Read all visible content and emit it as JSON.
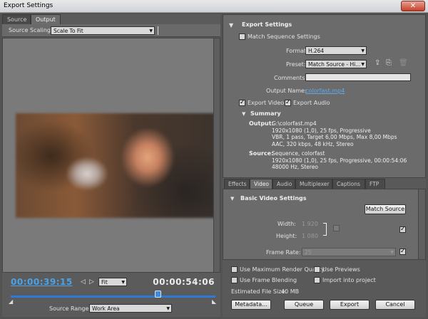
{
  "window": {
    "title": "Export Settings",
    "close_glyph": "✕"
  },
  "left": {
    "tabs": [
      "Source",
      "Output"
    ],
    "source_scaling": {
      "label": "Source Scaling:",
      "value": "Scale To Fit"
    },
    "timecode_current": "00:00:39:15",
    "timecode_duration": "00:00:54:06",
    "zoom": {
      "value": "Fit"
    },
    "playhead_fraction": 0.72,
    "source_range": {
      "label": "Source Range:",
      "value": "Work Area"
    }
  },
  "export_settings": {
    "heading": "Export Settings",
    "match_sequence_label": "Match Sequence Settings",
    "match_sequence_checked": false,
    "format_label": "Format:",
    "format_value": "H.264",
    "preset_label": "Preset:",
    "preset_value": "Match Source - Hi...",
    "comments_label": "Comments:",
    "comments_value": "",
    "output_name_label": "Output Name:",
    "output_name_value": "colorfast.mp4",
    "export_video_label": "Export Video",
    "export_video_checked": true,
    "export_audio_label": "Export Audio",
    "export_audio_checked": true,
    "summary_heading": "Summary",
    "summary_output_label": "Output:",
    "summary_output_lines": "G:\\colorfast.mp4\n1920x1080 (1,0), 25 fps, Progressive\nVBR, 1 pass, Target 6,00 Mbps, Max 8,00 Mbps\nAAC, 320 kbps, 48 kHz, Stereo",
    "summary_source_label": "Source:",
    "summary_source_lines": "Sequence, colorfast\n1920x1080 (1,0), 25 fps, Progressive, 00:00:54:06\n48000 Hz, Stereo"
  },
  "settings_tabs": [
    "Effects",
    "Video",
    "Audio",
    "Multiplexer",
    "Captions",
    "FTP"
  ],
  "video": {
    "heading": "Basic Video Settings",
    "match_source_button": "Match Source",
    "width_label": "Width:",
    "width_value": "1 920",
    "height_label": "Height:",
    "height_value": "1 080",
    "frame_rate_label": "Frame Rate:",
    "frame_rate_value": "25"
  },
  "bottom": {
    "max_render_label": "Use Maximum Render Quality",
    "use_previews_label": "Use Previews",
    "frame_blending_label": "Use Frame Blending",
    "import_into_project_label": "Import into project",
    "file_size_label": "Estimated File Size:",
    "file_size_value": "40 MB",
    "metadata_button": "Metadata...",
    "queue_button": "Queue",
    "export_button": "Export",
    "cancel_button": "Cancel"
  },
  "colors": {
    "accent_blue": "#4aa3e8",
    "panel_dark": "#535353",
    "panel_mid": "#6b6b6b"
  }
}
